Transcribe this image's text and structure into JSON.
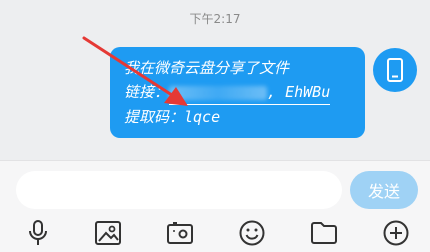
{
  "chat": {
    "timestamp": "下午2:17",
    "message": {
      "line1": "我在微奇云盘分享了文件",
      "line2_label": "链接：",
      "line2_link_tail": "EhWBu",
      "line3": "提取码：lqce"
    }
  },
  "input": {
    "placeholder": "",
    "send_label": "发送"
  },
  "toolbar": {
    "icons": [
      "microphone-icon",
      "image-icon",
      "video-icon",
      "emoji-icon",
      "folder-icon",
      "plus-icon"
    ]
  },
  "colors": {
    "bubble": "#1e9bf2",
    "send_button": "#9fd2f5",
    "arrow": "#e53935"
  }
}
